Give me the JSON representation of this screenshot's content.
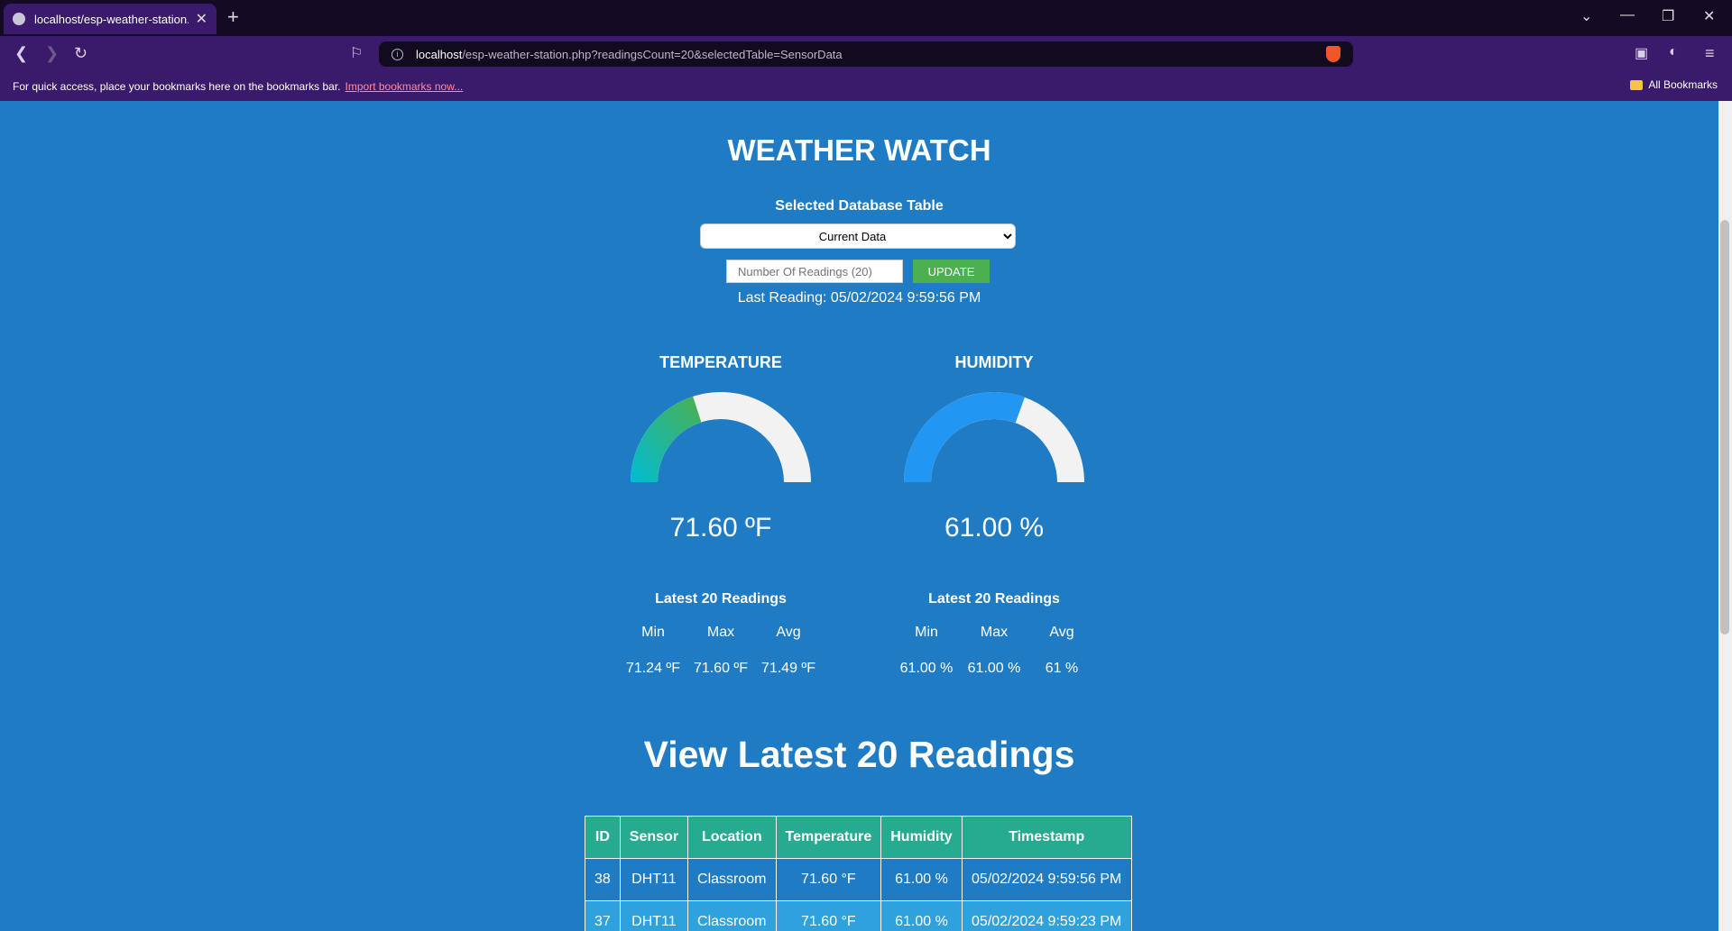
{
  "browser": {
    "tab_title": "localhost/esp-weather-station.p",
    "url_host": "localhost",
    "url_path": "/esp-weather-station.php?readingsCount=20&selectedTable=SensorData",
    "bookmarks_text": "For quick access, place your bookmarks here on the bookmarks bar.",
    "bookmarks_link": "Import bookmarks now...",
    "all_bookmarks": "All Bookmarks"
  },
  "page": {
    "title": "WEATHER WATCH",
    "select_label": "Selected Database Table",
    "select_value": "Current Data",
    "input_placeholder": "Number Of Readings (20)",
    "update_label": "UPDATE",
    "last_reading": "Last Reading: 05/02/2024 9:59:56 PM"
  },
  "temperature": {
    "title": "TEMPERATURE",
    "value": "71.60 ºF",
    "gauge_fraction": 0.4,
    "stats_title": "Latest 20 Readings",
    "min_label": "Min",
    "max_label": "Max",
    "avg_label": "Avg",
    "min": "71.24 ºF",
    "max": "71.60 ºF",
    "avg": "71.49 ºF"
  },
  "humidity": {
    "title": "HUMIDITY",
    "value": "61.00 %",
    "gauge_fraction": 0.61,
    "stats_title": "Latest 20 Readings",
    "min_label": "Min",
    "max_label": "Max",
    "avg_label": "Avg",
    "min": "61.00 %",
    "max": "61.00 %",
    "avg": "61 %"
  },
  "readings": {
    "heading": "View Latest 20 Readings",
    "columns": [
      "ID",
      "Sensor",
      "Location",
      "Temperature",
      "Humidity",
      "Timestamp"
    ],
    "rows": [
      [
        "38",
        "DHT11",
        "Classroom",
        "71.60 °F",
        "61.00 %",
        "05/02/2024 9:59:56 PM"
      ],
      [
        "37",
        "DHT11",
        "Classroom",
        "71.60 °F",
        "61.00 %",
        "05/02/2024 9:59:23 PM"
      ]
    ]
  },
  "colors": {
    "page_bg": "#1f7cc4",
    "header_row": "#26ab91",
    "even_row": "#2fa2de",
    "update_button": "#4caf50",
    "humidity_gauge": "#2196f3",
    "gauge_track": "#f2f2f2"
  }
}
